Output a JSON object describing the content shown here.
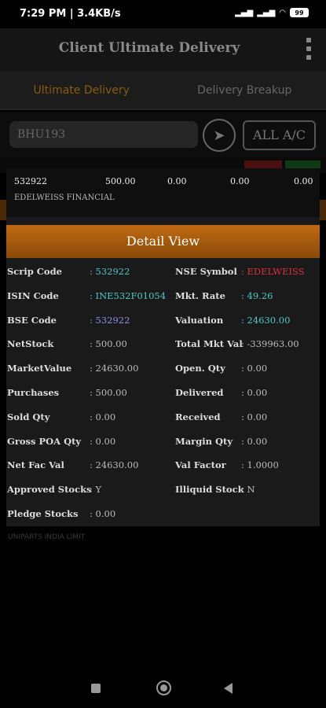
{
  "status_bar": {
    "time": "7:29 PM | 3.4KB/s",
    "battery": "99"
  },
  "app_bar": {
    "title": "Client Ultimate Delivery"
  },
  "tabs": [
    {
      "label": "Ultimate Delivery"
    },
    {
      "label": "Delivery Breakup"
    }
  ],
  "search": {
    "value": "BHU193",
    "all_label": "ALL A/C"
  },
  "summary": {
    "scrip_code": "532922",
    "values": [
      "500.00",
      "0.00",
      "0.00",
      "0.00"
    ],
    "name": "EDELWEISS FINANCIAL"
  },
  "detail_view": {
    "title": "Detail View",
    "left": [
      {
        "label": "Scrip Code",
        "value": ": 532922"
      },
      {
        "label": "ISIN Code",
        "value": ": INE532F01054"
      },
      {
        "label": "BSE Code",
        "value": ": 532922"
      },
      {
        "label": "NetStock",
        "value": ": 500.00"
      },
      {
        "label": "MarketValue",
        "value": ": 24630.00"
      },
      {
        "label": "Purchases",
        "value": ": 500.00"
      },
      {
        "label": "Sold Qty",
        "value": ": 0.00"
      },
      {
        "label": "Gross POA Qty",
        "value": ": 0.00"
      },
      {
        "label": "Net Fac Val",
        "value": ": 24630.00"
      },
      {
        "label": "Approved Stocks",
        "value": ": Y"
      },
      {
        "label": "Pledge Stocks",
        "value": ": 0.00"
      }
    ],
    "right": [
      {
        "label": "NSE Symbol",
        "value": ": EDELWEISS"
      },
      {
        "label": "Mkt. Rate",
        "value": ": 49.26"
      },
      {
        "label": "Valuation",
        "value": ": 24630.00"
      },
      {
        "label": "Total Mkt Val",
        "value": ": -339963.00"
      },
      {
        "label": "Open. Qty",
        "value": ": 0.00"
      },
      {
        "label": "Delivered",
        "value": ": 0.00"
      },
      {
        "label": "Received",
        "value": ": 0.00"
      },
      {
        "label": "Margin Qty",
        "value": ": 0.00"
      },
      {
        "label": "Val Factor",
        "value": ": 1.0000"
      },
      {
        "label": "Illiquid Stock",
        "value": ": N"
      }
    ]
  },
  "background_item": "UNIPARTS INDIA LIMIT",
  "colors": {
    "accent": "#c06a12",
    "cyan": "#4fc8c8",
    "purple": "#8f8ff0",
    "red": "#e0303a"
  }
}
